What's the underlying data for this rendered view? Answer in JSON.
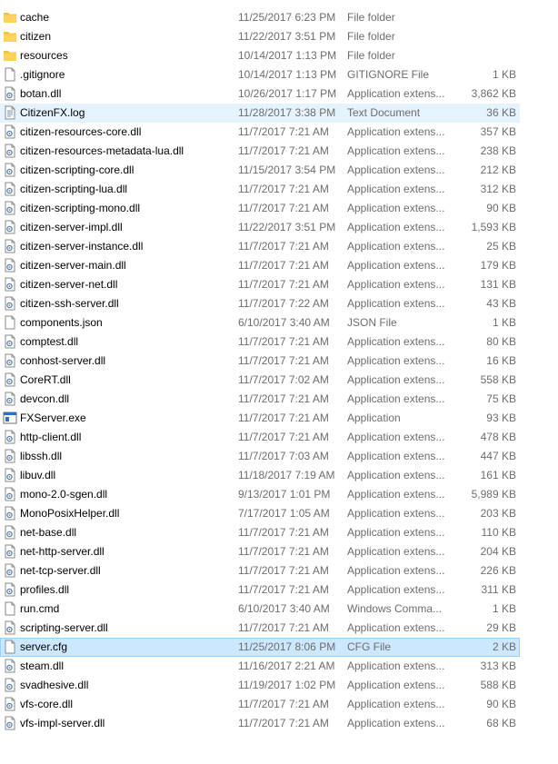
{
  "files": [
    {
      "name": "cache",
      "date": "11/25/2017 6:23 PM",
      "type": "File folder",
      "size": "",
      "icon": "folder-icon"
    },
    {
      "name": "citizen",
      "date": "11/22/2017 3:51 PM",
      "type": "File folder",
      "size": "",
      "icon": "folder-icon"
    },
    {
      "name": "resources",
      "date": "10/14/2017 1:13 PM",
      "type": "File folder",
      "size": "",
      "icon": "folder-icon"
    },
    {
      "name": ".gitignore",
      "date": "10/14/2017 1:13 PM",
      "type": "GITIGNORE File",
      "size": "1 KB",
      "icon": "file-icon"
    },
    {
      "name": "botan.dll",
      "date": "10/26/2017 1:17 PM",
      "type": "Application extens...",
      "size": "3,862 KB",
      "icon": "dll-icon"
    },
    {
      "name": "CitizenFX.log",
      "date": "11/28/2017 3:38 PM",
      "type": "Text Document",
      "size": "36 KB",
      "icon": "text-document-icon",
      "state": "hover"
    },
    {
      "name": "citizen-resources-core.dll",
      "date": "11/7/2017 7:21 AM",
      "type": "Application extens...",
      "size": "357 KB",
      "icon": "dll-icon"
    },
    {
      "name": "citizen-resources-metadata-lua.dll",
      "date": "11/7/2017 7:21 AM",
      "type": "Application extens...",
      "size": "238 KB",
      "icon": "dll-icon"
    },
    {
      "name": "citizen-scripting-core.dll",
      "date": "11/15/2017 3:54 PM",
      "type": "Application extens...",
      "size": "212 KB",
      "icon": "dll-icon"
    },
    {
      "name": "citizen-scripting-lua.dll",
      "date": "11/7/2017 7:21 AM",
      "type": "Application extens...",
      "size": "312 KB",
      "icon": "dll-icon"
    },
    {
      "name": "citizen-scripting-mono.dll",
      "date": "11/7/2017 7:21 AM",
      "type": "Application extens...",
      "size": "90 KB",
      "icon": "dll-icon"
    },
    {
      "name": "citizen-server-impl.dll",
      "date": "11/22/2017 3:51 PM",
      "type": "Application extens...",
      "size": "1,593 KB",
      "icon": "dll-icon"
    },
    {
      "name": "citizen-server-instance.dll",
      "date": "11/7/2017 7:21 AM",
      "type": "Application extens...",
      "size": "25 KB",
      "icon": "dll-icon"
    },
    {
      "name": "citizen-server-main.dll",
      "date": "11/7/2017 7:21 AM",
      "type": "Application extens...",
      "size": "179 KB",
      "icon": "dll-icon"
    },
    {
      "name": "citizen-server-net.dll",
      "date": "11/7/2017 7:21 AM",
      "type": "Application extens...",
      "size": "131 KB",
      "icon": "dll-icon"
    },
    {
      "name": "citizen-ssh-server.dll",
      "date": "11/7/2017 7:22 AM",
      "type": "Application extens...",
      "size": "43 KB",
      "icon": "dll-icon"
    },
    {
      "name": "components.json",
      "date": "6/10/2017 3:40 AM",
      "type": "JSON File",
      "size": "1 KB",
      "icon": "file-icon"
    },
    {
      "name": "comptest.dll",
      "date": "11/7/2017 7:21 AM",
      "type": "Application extens...",
      "size": "80 KB",
      "icon": "dll-icon"
    },
    {
      "name": "conhost-server.dll",
      "date": "11/7/2017 7:21 AM",
      "type": "Application extens...",
      "size": "16 KB",
      "icon": "dll-icon"
    },
    {
      "name": "CoreRT.dll",
      "date": "11/7/2017 7:02 AM",
      "type": "Application extens...",
      "size": "558 KB",
      "icon": "dll-icon"
    },
    {
      "name": "devcon.dll",
      "date": "11/7/2017 7:21 AM",
      "type": "Application extens...",
      "size": "75 KB",
      "icon": "dll-icon"
    },
    {
      "name": "FXServer.exe",
      "date": "11/7/2017 7:21 AM",
      "type": "Application",
      "size": "93 KB",
      "icon": "application-icon"
    },
    {
      "name": "http-client.dll",
      "date": "11/7/2017 7:21 AM",
      "type": "Application extens...",
      "size": "478 KB",
      "icon": "dll-icon"
    },
    {
      "name": "libssh.dll",
      "date": "11/7/2017 7:03 AM",
      "type": "Application extens...",
      "size": "447 KB",
      "icon": "dll-icon"
    },
    {
      "name": "libuv.dll",
      "date": "11/18/2017 7:19 AM",
      "type": "Application extens...",
      "size": "161 KB",
      "icon": "dll-icon"
    },
    {
      "name": "mono-2.0-sgen.dll",
      "date": "9/13/2017 1:01 PM",
      "type": "Application extens...",
      "size": "5,989 KB",
      "icon": "dll-icon"
    },
    {
      "name": "MonoPosixHelper.dll",
      "date": "7/17/2017 1:05 AM",
      "type": "Application extens...",
      "size": "203 KB",
      "icon": "dll-icon"
    },
    {
      "name": "net-base.dll",
      "date": "11/7/2017 7:21 AM",
      "type": "Application extens...",
      "size": "110 KB",
      "icon": "dll-icon"
    },
    {
      "name": "net-http-server.dll",
      "date": "11/7/2017 7:21 AM",
      "type": "Application extens...",
      "size": "204 KB",
      "icon": "dll-icon"
    },
    {
      "name": "net-tcp-server.dll",
      "date": "11/7/2017 7:21 AM",
      "type": "Application extens...",
      "size": "226 KB",
      "icon": "dll-icon"
    },
    {
      "name": "profiles.dll",
      "date": "11/7/2017 7:21 AM",
      "type": "Application extens...",
      "size": "311 KB",
      "icon": "dll-icon"
    },
    {
      "name": "run.cmd",
      "date": "6/10/2017 3:40 AM",
      "type": "Windows Comma...",
      "size": "1 KB",
      "icon": "file-icon"
    },
    {
      "name": "scripting-server.dll",
      "date": "11/7/2017 7:21 AM",
      "type": "Application extens...",
      "size": "29 KB",
      "icon": "dll-icon"
    },
    {
      "name": "server.cfg",
      "date": "11/25/2017 8:06 PM",
      "type": "CFG File",
      "size": "2 KB",
      "icon": "file-icon",
      "state": "selected"
    },
    {
      "name": "steam.dll",
      "date": "11/16/2017 2:21 AM",
      "type": "Application extens...",
      "size": "313 KB",
      "icon": "dll-icon"
    },
    {
      "name": "svadhesive.dll",
      "date": "11/19/2017 1:02 PM",
      "type": "Application extens...",
      "size": "588 KB",
      "icon": "dll-icon"
    },
    {
      "name": "vfs-core.dll",
      "date": "11/7/2017 7:21 AM",
      "type": "Application extens...",
      "size": "90 KB",
      "icon": "dll-icon"
    },
    {
      "name": "vfs-impl-server.dll",
      "date": "11/7/2017 7:21 AM",
      "type": "Application extens...",
      "size": "68 KB",
      "icon": "dll-icon"
    }
  ],
  "colors": {
    "hover_row": "#e5f3ff",
    "selected_row": "#cce8ff",
    "selected_border": "#99d1ff",
    "folder": "#ffd35b"
  }
}
